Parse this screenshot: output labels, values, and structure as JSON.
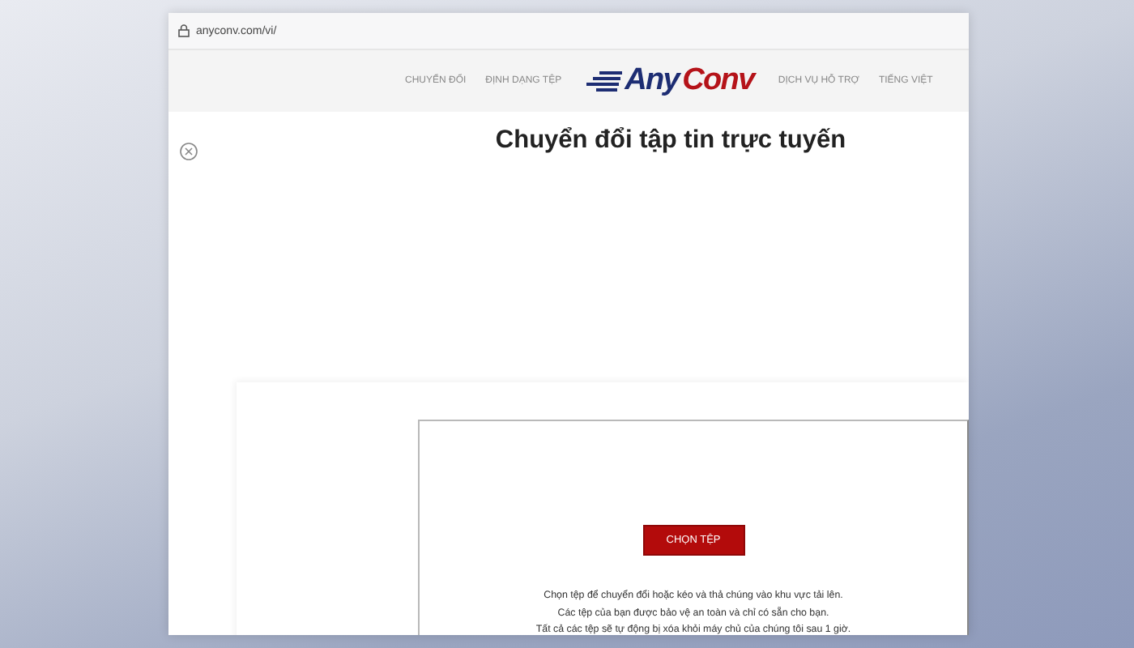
{
  "address_bar": {
    "url": "anyconv.com/vi/"
  },
  "nav": {
    "items_left": [
      "CHUYỂN ĐỔI",
      "ĐỊNH DẠNG TỆP"
    ],
    "logo": {
      "part_1": "Any",
      "part_2": "Conv"
    },
    "items_right": [
      "DỊCH VỤ HỖ TRỢ",
      "TIẾNG VIỆT"
    ]
  },
  "page": {
    "title": "Chuyển đổi tập tin trực tuyến",
    "upload": {
      "button": "CHỌN TỆP",
      "lines": [
        "Chọn tệp để chuyển đổi hoặc kéo và thả chúng vào khu vực tải lên.",
        "Các tệp của bạn được bảo vệ an toàn và chỉ có sẵn cho bạn.",
        "Tất cả các tệp sẽ tự động bị xóa khỏi máy chủ của chúng tôi sau 1 giờ."
      ]
    }
  }
}
